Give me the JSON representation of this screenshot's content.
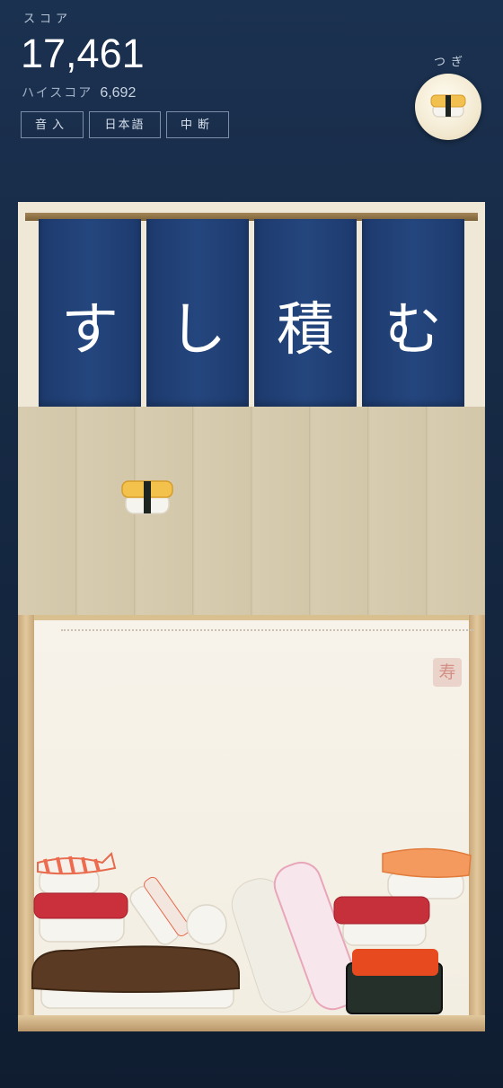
{
  "hud": {
    "score_label": "スコア",
    "score": "17,461",
    "highscore_label": "ハイスコア",
    "highscore": "6,692",
    "buttons": [
      "音入",
      "日本語",
      "中断"
    ],
    "next_label": "つぎ",
    "next_piece": "tamago-nigiri"
  },
  "stage": {
    "noren": [
      "す",
      "し",
      "積",
      "む"
    ],
    "stamp": "寿",
    "falling_piece": "tamago-nigiri",
    "stacked_pieces": [
      "ebi",
      "maguro",
      "ebi",
      "rice-ball",
      "unagi",
      "ika",
      "tako",
      "salmon",
      "maguro",
      "ikura-gunkan"
    ]
  },
  "colors": {
    "noren": "#1f3e73",
    "background": "#16293f"
  }
}
